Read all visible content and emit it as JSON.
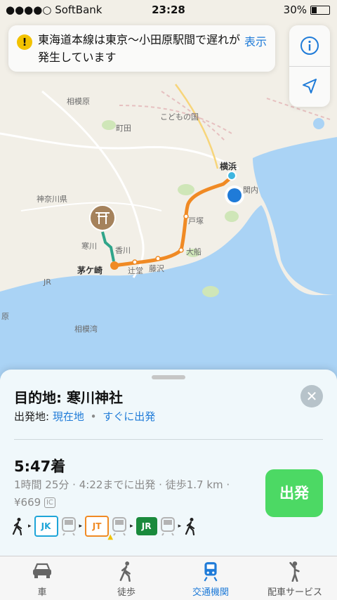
{
  "status": {
    "carrier": "●●●●○ SoftBank",
    "time": "23:28",
    "battery": "30%"
  },
  "alert": {
    "message": "東海道本線は東京〜小田原駅間で遅れが発生しています",
    "action": "表示"
  },
  "map": {
    "labels": {
      "sagamihara": "相模原",
      "machida": "町田",
      "kodomo": "こどもの国",
      "yokohama": "横浜",
      "kannai": "関内",
      "kanagawa": "神奈川県",
      "totsuka": "戸塚",
      "ofuna": "大船",
      "samukawa": "寒川",
      "kawa": "香川",
      "chigasaki": "茅ケ崎",
      "tsujido": "辻堂",
      "fujisawa": "藤沢",
      "jr": "JR",
      "hara": "原",
      "sagamiwan": "相模湾"
    },
    "colors": {
      "water": "#aad3f5",
      "land": "#f2efe7",
      "orange_line": "#f08a24",
      "teal_line": "#2fa58a",
      "user": "#1f7bd8"
    }
  },
  "card": {
    "destination": "目的地: 寒川神社",
    "from_label": "出発地:",
    "from_value": "現在地",
    "bullet": "•",
    "depart_when": "すぐに出発",
    "arrival": "5:47着",
    "details": "1時間 25分 · 4:22までに出発 · 徒歩1.7 km · ¥669",
    "ic": "IC",
    "go_button": "出発",
    "steps": [
      {
        "type": "walk",
        "icon": "walk-icon"
      },
      {
        "type": "line",
        "code": "JK",
        "color": "#1ea5d8"
      },
      {
        "type": "line",
        "code": "JT",
        "color": "#f08a24",
        "warning": true
      },
      {
        "type": "line",
        "code": "JR",
        "color": "#1a8a3c"
      },
      {
        "type": "walk",
        "icon": "walk-icon"
      }
    ]
  },
  "tabs": [
    {
      "label": "車",
      "icon": "car-icon"
    },
    {
      "label": "徒歩",
      "icon": "walk-icon"
    },
    {
      "label": "交通機関",
      "icon": "train-icon",
      "active": true
    },
    {
      "label": "配車サービス",
      "icon": "ride-icon"
    }
  ]
}
